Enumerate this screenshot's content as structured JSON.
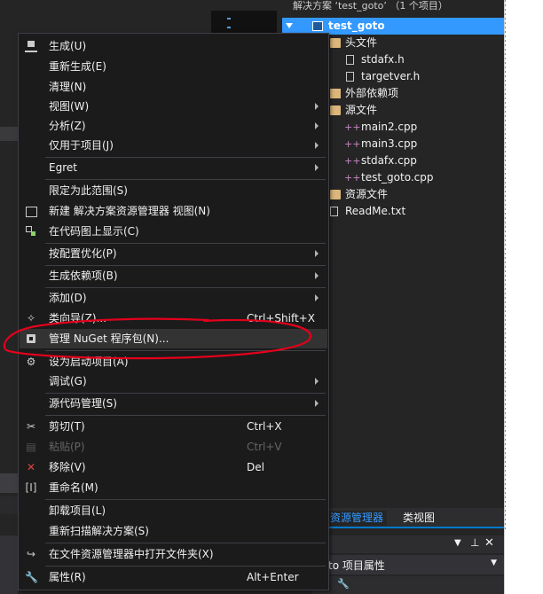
{
  "solution_explorer": {
    "header": "解决方案 ‘test_goto’ （1 个项目）",
    "tree": [
      {
        "label": "test_goto",
        "icon": "project-icon",
        "selected": true
      },
      {
        "label": "头文件",
        "icon": "folder-icon"
      },
      {
        "label": "stdafx.h",
        "icon": "header-file-icon"
      },
      {
        "label": "targetver.h",
        "icon": "header-file-icon"
      },
      {
        "label": "外部依赖项",
        "icon": "external-deps-icon"
      },
      {
        "label": "源文件",
        "icon": "folder-icon"
      },
      {
        "label": "main2.cpp",
        "icon": "cpp-file-icon"
      },
      {
        "label": "main3.cpp",
        "icon": "cpp-file-icon"
      },
      {
        "label": "stdafx.cpp",
        "icon": "cpp-file-icon"
      },
      {
        "label": "test_goto.cpp",
        "icon": "cpp-file-icon"
      },
      {
        "label": "资源文件",
        "icon": "folder-icon"
      },
      {
        "label": "ReadMe.txt",
        "icon": "text-file-icon"
      }
    ],
    "tabs": {
      "active": "资源管理器",
      "inactive": "类视图"
    }
  },
  "properties_panel": {
    "title_bar_label": "to  项目属性"
  },
  "context_menu": {
    "items": {
      "build": {
        "label": "生成(U)"
      },
      "rebuild": {
        "label": "重新生成(E)"
      },
      "clean": {
        "label": "清理(N)"
      },
      "view": {
        "label": "视图(W)"
      },
      "analyze": {
        "label": "分析(Z)"
      },
      "project_only": {
        "label": "仅用于项目(J)"
      },
      "egret": {
        "label": "Egret"
      },
      "scope_to_this": {
        "label": "限定为此范围(S)"
      },
      "new_se_view": {
        "label": "新建 解决方案资源管理器 视图(N)"
      },
      "show_on_codemap": {
        "label": "在代码图上显示(C)"
      },
      "pgo": {
        "label": "按配置优化(P)"
      },
      "build_deps": {
        "label": "生成依赖项(B)"
      },
      "add": {
        "label": "添加(D)"
      },
      "class_wizard": {
        "label": "类向导(Z)...",
        "shortcut": "Ctrl+Shift+X"
      },
      "manage_nuget": {
        "label": "管理 NuGet 程序包(N)..."
      },
      "set_startup": {
        "label": "设为启动项目(A)"
      },
      "debug": {
        "label": "调试(G)"
      },
      "source_control": {
        "label": "源代码管理(S)"
      },
      "cut": {
        "label": "剪切(T)",
        "shortcut": "Ctrl+X"
      },
      "paste": {
        "label": "粘贴(P)",
        "shortcut": "Ctrl+V"
      },
      "remove": {
        "label": "移除(V)",
        "shortcut": "Del"
      },
      "rename": {
        "label": "重命名(M)"
      },
      "unload": {
        "label": "卸载项目(L)"
      },
      "rescan": {
        "label": "重新扫描解决方案(S)"
      },
      "open_in_explorer": {
        "label": "在文件资源管理器中打开文件夹(X)"
      },
      "properties": {
        "label": "属性(R)",
        "shortcut": "Alt+Enter"
      }
    }
  },
  "colors": {
    "menu_bg": "#1b1b1c",
    "highlight": "#333334",
    "selection": "#3399ff",
    "annotation_red": "#e3001b"
  }
}
